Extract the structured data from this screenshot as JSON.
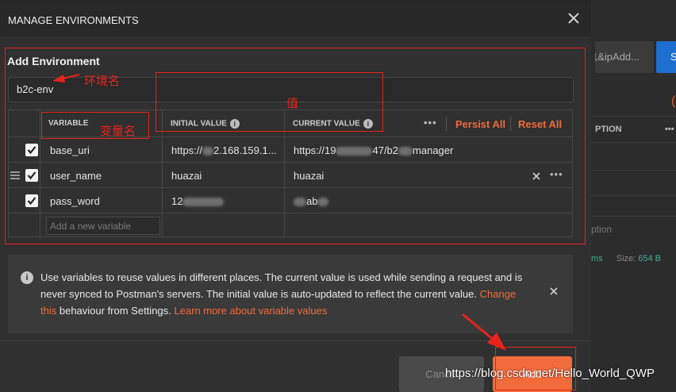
{
  "modal": {
    "title": "MANAGE ENVIRONMENTS",
    "section_title": "Add Environment",
    "env_name": "b2c-env"
  },
  "table": {
    "headers": {
      "variable": "VARIABLE",
      "initial": "INITIAL VALUE",
      "current": "CURRENT VALUE",
      "persist_all": "Persist All",
      "reset_all": "Reset All"
    },
    "rows": [
      {
        "variable": "base_uri",
        "initial": "https://",
        "initial_tail": "2.168.159.1...",
        "current": "https://19",
        "current_tail": "47/b2",
        "current_end": "manager"
      },
      {
        "variable": "user_name",
        "initial": "huazai",
        "current": "huazai"
      },
      {
        "variable": "pass_word",
        "initial": "12",
        "current": "ab"
      }
    ],
    "new_placeholder": "Add a new variable"
  },
  "info": {
    "text1": "Use variables to reuse values in different places. The current value is used while sending a request and is never synced to Postman's servers. The initial value is auto-updated to reflect the current value.",
    "link_change": "Change this",
    "text2": "behaviour from Settings.",
    "link_learn": "Learn more about variable values"
  },
  "buttons": {
    "cancel": "Cancel",
    "add": "Add"
  },
  "background": {
    "button_text": "1&ipAdd...",
    "button_blue_text": "S",
    "header_text": "PTION",
    "option_text": "ption",
    "status_ms": "ms",
    "status_size_label": "Size:",
    "status_size_value": "654 B"
  },
  "annotations": {
    "env_name": "环境名",
    "variable": "变量名",
    "value": "值"
  },
  "watermark": "https://blog.csdn.net/Hello_World_QWP",
  "colors": {
    "accent": "#f26b3a",
    "annotation": "#e8231b",
    "blue": "#1f6fd0"
  }
}
